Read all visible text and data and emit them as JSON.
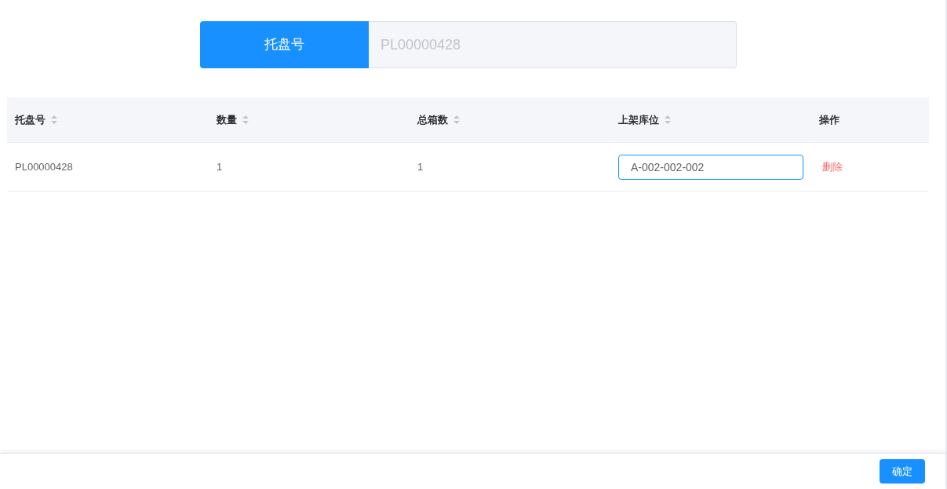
{
  "search": {
    "label": "托盘号",
    "placeholder": "PL00000428"
  },
  "table": {
    "columns": [
      {
        "label": "托盘号",
        "sortable": true
      },
      {
        "label": "数量",
        "sortable": true
      },
      {
        "label": "总箱数",
        "sortable": true
      },
      {
        "label": "上架库位",
        "sortable": true
      },
      {
        "label": "操作",
        "sortable": false
      }
    ],
    "rows": [
      [
        {
          "kind": "text",
          "text": "PL00000428"
        },
        {
          "kind": "text",
          "text": "1"
        },
        {
          "kind": "text",
          "text": "1"
        },
        {
          "kind": "input",
          "value": "A-002-002-002"
        },
        {
          "kind": "link",
          "text": "删除"
        }
      ]
    ]
  },
  "footer": {
    "buttons": [
      "确定"
    ]
  }
}
